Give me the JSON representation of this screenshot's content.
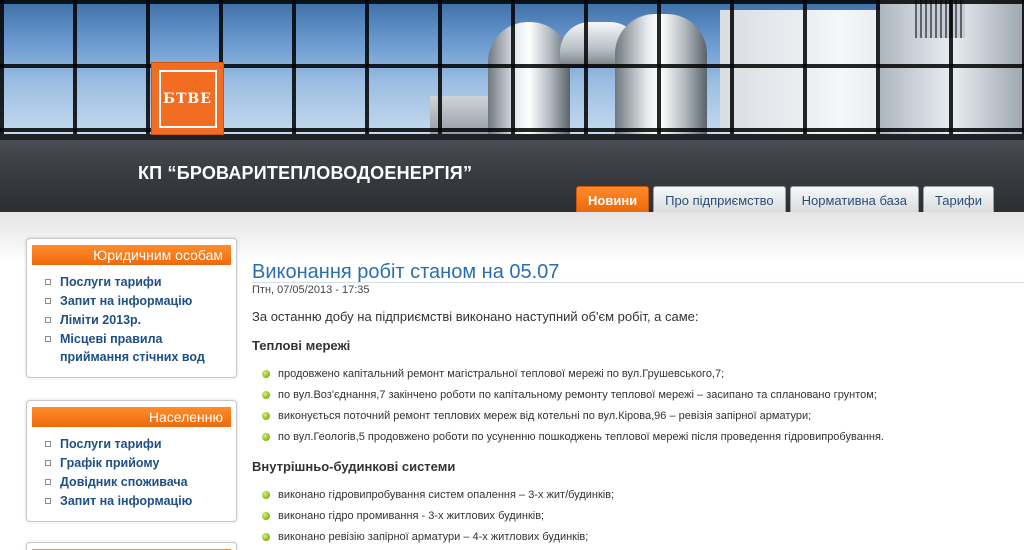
{
  "brand": {
    "logo_text": "БТВЕ",
    "site_title": "КП “БРОВАРИТЕПЛОВОДОЕНЕРГІЯ”"
  },
  "nav": {
    "tabs": [
      {
        "label": "Новини",
        "active": true
      },
      {
        "label": "Про підприємство",
        "active": false
      },
      {
        "label": "Нормативна база",
        "active": false
      },
      {
        "label": "Тарифи",
        "active": false
      }
    ]
  },
  "sidebar": {
    "boxes": [
      {
        "title": "Юридичним особам",
        "items": [
          "Послуги тарифи",
          "Запит на інформацію",
          "Ліміти 2013р.",
          "Місцеві правила приймання стічних вод"
        ]
      },
      {
        "title": "Населенню",
        "items": [
          "Послуги тарифи",
          "Графік прийому",
          "Довідник споживача",
          "Запит на інформацію"
        ]
      }
    ]
  },
  "article": {
    "title": "Виконання робіт станом на 05.07",
    "date": "Птн, 07/05/2013 - 17:35",
    "intro": "За останню добу на підприємстві виконано наступний об'єм робіт, а саме:",
    "sections": [
      {
        "heading": "Теплові мережі",
        "items": [
          "продовжено капітальний ремонт магістральної теплової мережі по вул.Грушевського,7;",
          "по вул.Воз'єднання,7 закінчено роботи по капітальному ремонту теплової мережі – засипано та сплановано грунтом;",
          "виконується поточний ремонт теплових мереж від котельні по вул.Кірова,96 – ревізія запірної арматури;",
          "по вул.Геологів,5 продовжено роботи по усуненню пошкоджень теплової мережі після проведення гідровипробування."
        ]
      },
      {
        "heading": "Внутрішньо-будинкові системи",
        "items": [
          "виконано гідровипробування систем опалення – 3-х жит/будинків;",
          "виконано гідро промивання - 3-х житлових будинків;",
          "виконано ревізію запірної арматури – 4-х житлових будинків;"
        ]
      }
    ]
  },
  "colors": {
    "accent_orange": "#ee6a0b",
    "link_blue": "#1f4f85",
    "title_blue": "#2a6fb2",
    "bullet_green": "#8cbf1e"
  }
}
